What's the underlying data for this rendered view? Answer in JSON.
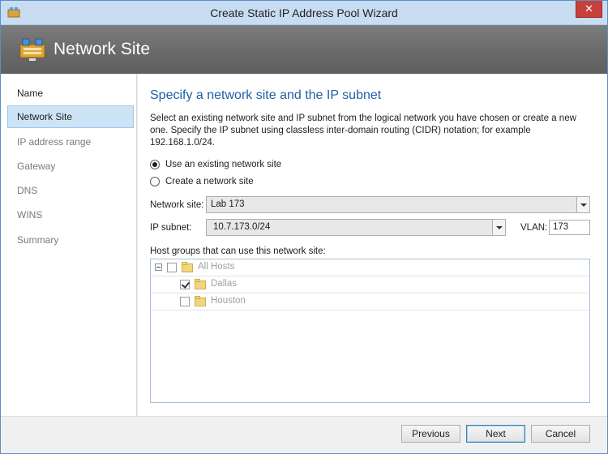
{
  "window": {
    "title": "Create Static IP Address Pool Wizard",
    "close_glyph": "✕"
  },
  "header": {
    "title": "Network Site",
    "icon": "network-site-icon"
  },
  "nav": {
    "items": [
      {
        "label": "Name",
        "state": "done"
      },
      {
        "label": "Network Site",
        "state": "active"
      },
      {
        "label": "IP address range",
        "state": "pending"
      },
      {
        "label": "Gateway",
        "state": "pending"
      },
      {
        "label": "DNS",
        "state": "pending"
      },
      {
        "label": "WINS",
        "state": "pending"
      },
      {
        "label": "Summary",
        "state": "pending"
      }
    ]
  },
  "main": {
    "title": "Specify a network site and the IP subnet",
    "description": "Select an existing network site and IP subnet from the logical network you have chosen or create a new one. Specify the IP subnet using classless inter-domain routing (CIDR) notation; for example 192.168.1.0/24.",
    "options": [
      {
        "label": "Use an existing network site",
        "selected": true
      },
      {
        "label": "Create a network site",
        "selected": false
      }
    ],
    "network_site_label": "Network site:",
    "network_site_value": "Lab 173",
    "ip_subnet_label": "IP subnet:",
    "ip_subnet_value": "10.7.173.0/24",
    "vlan_label": "VLAN:",
    "vlan_value": "173",
    "host_groups_label": "Host groups that can use this network site:",
    "host_groups": [
      {
        "label": "All Hosts",
        "checked": false
      },
      {
        "label": "Dallas",
        "checked": true
      },
      {
        "label": "Houston",
        "checked": false
      }
    ]
  },
  "footer": {
    "previous": "Previous",
    "next": "Next",
    "cancel": "Cancel"
  },
  "colors": {
    "accent": "#1f5fa8",
    "nav_active": "#cde4f7",
    "close": "#c7403a"
  }
}
